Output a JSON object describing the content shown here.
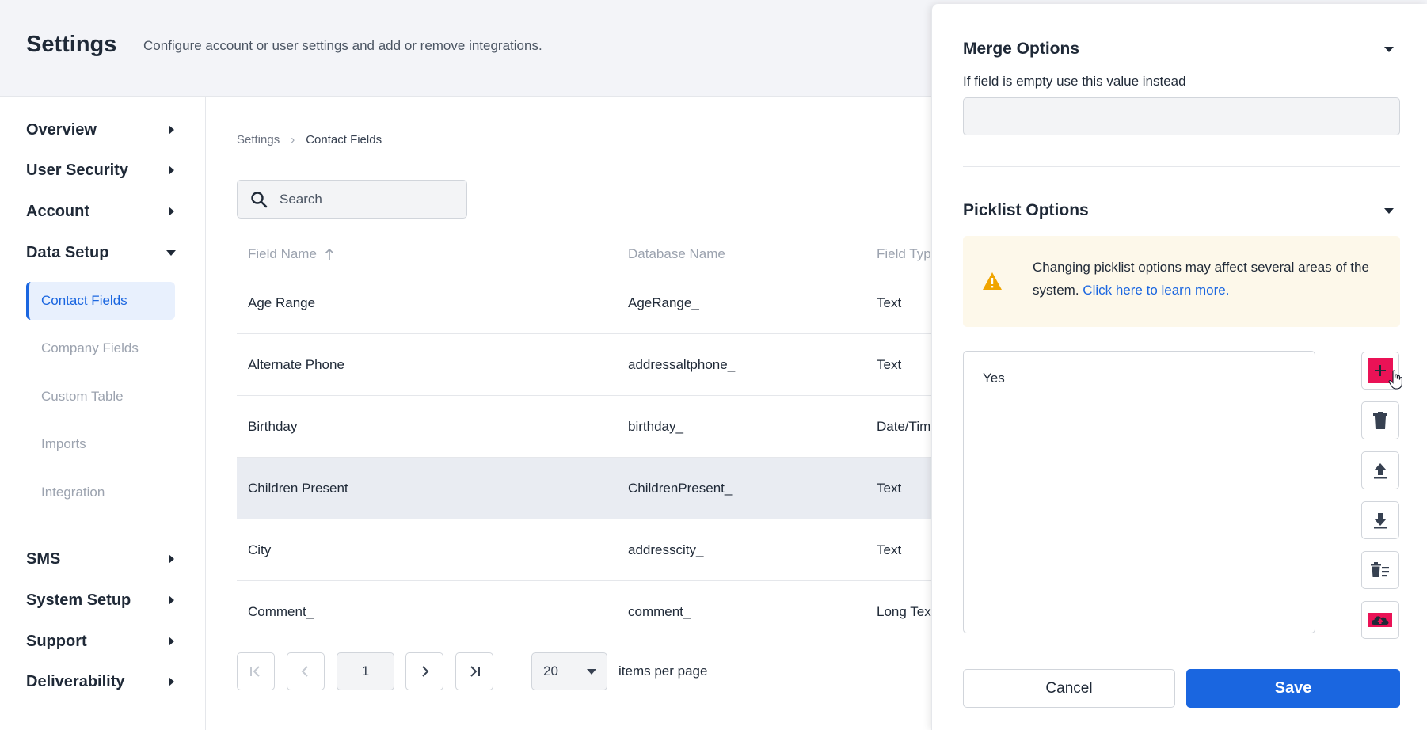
{
  "header": {
    "title": "Settings",
    "subtitle": "Configure account or user settings and add or remove integrations."
  },
  "sidebar": {
    "sections": [
      {
        "label": "Overview",
        "state": "collapsed"
      },
      {
        "label": "User Security",
        "state": "collapsed"
      },
      {
        "label": "Account",
        "state": "collapsed"
      },
      {
        "label": "Data Setup",
        "state": "expanded"
      },
      {
        "label": "SMS",
        "state": "collapsed"
      },
      {
        "label": "System Setup",
        "state": "collapsed"
      },
      {
        "label": "Support",
        "state": "collapsed"
      },
      {
        "label": "Deliverability",
        "state": "collapsed"
      }
    ],
    "data_setup_items": [
      {
        "label": "Contact Fields",
        "active": true
      },
      {
        "label": "Company Fields",
        "active": false
      },
      {
        "label": "Custom Table",
        "active": false
      },
      {
        "label": "Imports",
        "active": false
      },
      {
        "label": "Integration",
        "active": false
      }
    ]
  },
  "breadcrumb": {
    "parent": "Settings",
    "separator": "›",
    "current": "Contact Fields"
  },
  "search": {
    "placeholder": "Search",
    "icon": "search-icon"
  },
  "table": {
    "columns": [
      "Field Name",
      "Database Name",
      "Field Type"
    ],
    "sort": {
      "column": "Field Name",
      "direction": "ascending",
      "icon": "arrow-up-icon"
    },
    "rows": [
      {
        "field_name": "Age Range",
        "database_name": "AgeRange_",
        "field_type": "Text",
        "selected": false
      },
      {
        "field_name": "Alternate Phone",
        "database_name": "addressaltphone_",
        "field_type": "Text",
        "selected": false
      },
      {
        "field_name": "Birthday",
        "database_name": "birthday_",
        "field_type": "Date/Time",
        "selected": false
      },
      {
        "field_name": "Children Present",
        "database_name": "ChildrenPresent_",
        "field_type": "Text",
        "selected": true
      },
      {
        "field_name": "City",
        "database_name": "addresscity_",
        "field_type": "Text",
        "selected": false
      },
      {
        "field_name": "Comment_",
        "database_name": "comment_",
        "field_type": "Long Text",
        "selected": false
      }
    ]
  },
  "pagination": {
    "current_page": "1",
    "per_page": "20",
    "per_page_label": "items per page"
  },
  "drawer": {
    "merge_options": {
      "title": "Merge Options",
      "field_label": "If field is empty use this value instead",
      "value": ""
    },
    "picklist_options": {
      "title": "Picklist Options",
      "warning_text": "Changing picklist options may affect several areas of the system.",
      "warning_link": "Click here to learn more.",
      "options": [
        "Yes"
      ],
      "tools": [
        "add-icon",
        "trash-icon",
        "move-up-icon",
        "move-down-icon",
        "clear-list-icon",
        "cloud-upload-icon"
      ]
    },
    "cancel_label": "Cancel",
    "save_label": "Save"
  },
  "colors": {
    "accent": "#1a66e0",
    "add_button": "#ea1256",
    "warning_bg": "#fdf8ea",
    "warning_icon": "#f0a500",
    "selected_row": "#e9ecf2",
    "header_bg": "#f3f4f8"
  }
}
